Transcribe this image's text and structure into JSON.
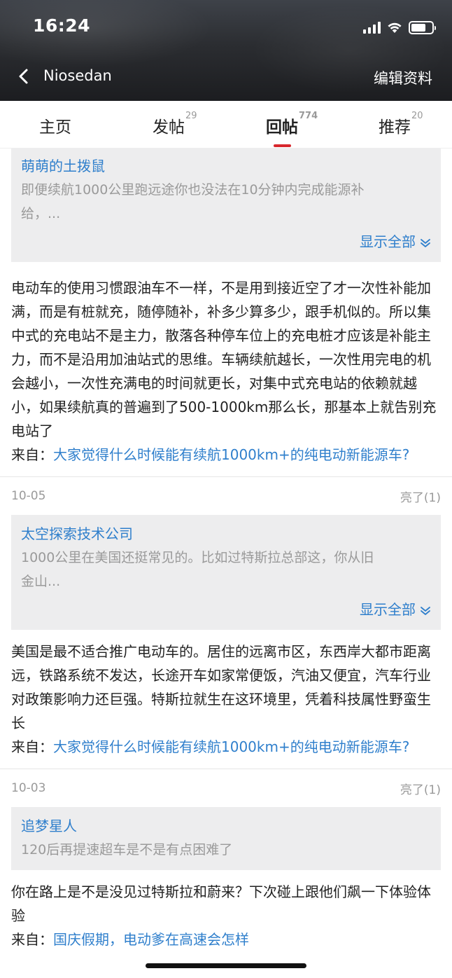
{
  "status_bar": {
    "time": "16:24"
  },
  "nav": {
    "title": "Niosedan",
    "edit_label": "编辑资料"
  },
  "tabs": [
    {
      "label": "主页",
      "count": ""
    },
    {
      "label": "发帖",
      "count": "29"
    },
    {
      "label": "回帖",
      "count": "774"
    },
    {
      "label": "推荐",
      "count": "20"
    }
  ],
  "posts": [
    {
      "quote": {
        "author": "萌萌的土拨鼠",
        "text_line1": "即便续航1000公里跑远途你也没法在10分钟内完成能源补",
        "text_line2": "给，...",
        "more_label": "显示全部"
      },
      "body": "电动车的使用习惯跟油车不一样，不是用到接近空了才一次性补能加满，而是有桩就充，随停随补，补多少算多少，跟手机似的。所以集中式的充电站不是主力，散落各种停车位上的充电桩才应该是补能主力，而不是沿用加油站式的思维。车辆续航越长，一次性用完电的机会越小，一次性充满电的时间就更长，对集中式充电站的依赖就越小，如果续航真的普遍到了500-1000km那么长，那基本上就告别充电站了",
      "source_prefix": "来自：",
      "source_link": "大家觉得什么时候能有续航1000km+的纯电动新能源车?"
    },
    {
      "date": "10-05",
      "likes": "亮了(1)",
      "quote": {
        "author": "太空探索技术公司",
        "text_line1": "1000公里在美国还挺常见的。比如过特斯拉总部这，你从旧",
        "text_line2": "金山...",
        "more_label": "显示全部"
      },
      "body": "美国是最不适合推广电动车的。居住的远离市区，东西岸大都市距离远，铁路系统不发达，长途开车如家常便饭，汽油又便宜，汽车行业对政策影响力还巨强。特斯拉就生在这环境里，凭着科技属性野蛮生长",
      "source_prefix": "来自：",
      "source_link": "大家觉得什么时候能有续航1000km+的纯电动新能源车?"
    },
    {
      "date": "10-03",
      "likes": "亮了(1)",
      "quote": {
        "author": "追梦星人",
        "text_line1": "120后再提速超车是不是有点困难了"
      },
      "body": "你在路上是不是没见过特斯拉和蔚来？下次碰上跟他们飙一下体验体验",
      "source_prefix": "来自：",
      "source_link": "国庆假期，电动爹在高速会怎样"
    }
  ]
}
